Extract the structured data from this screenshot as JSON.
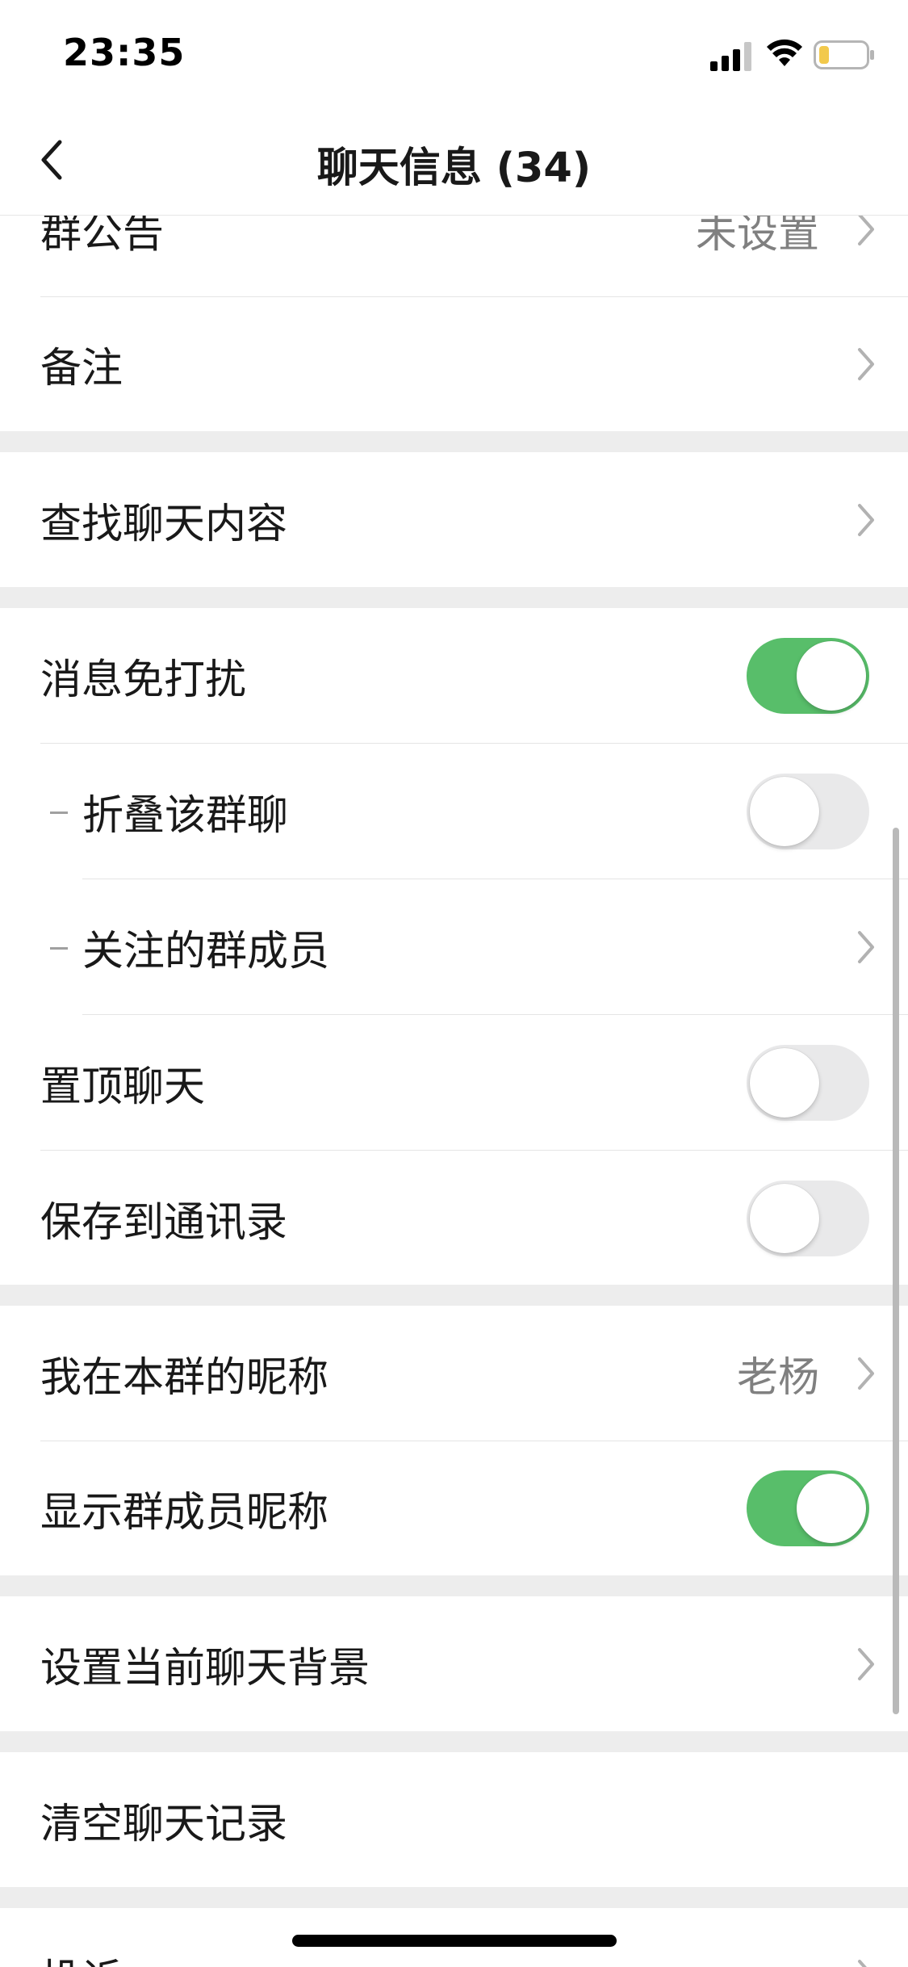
{
  "status_bar": {
    "time": "23:35",
    "icons": [
      "signal-icon",
      "wifi-icon",
      "battery-icon"
    ]
  },
  "nav": {
    "title": "聊天信息 (34)",
    "back_icon": "chevron-left-icon"
  },
  "rows": {
    "announcement": {
      "label": "群公告",
      "value": "未设置"
    },
    "remark": {
      "label": "备注"
    },
    "search_chat": {
      "label": "查找聊天内容"
    },
    "mute": {
      "label": "消息免打扰",
      "toggle": "on"
    },
    "fold_chat": {
      "label": "折叠该群聊",
      "toggle": "off"
    },
    "followed_members": {
      "label": "关注的群成员"
    },
    "pin_chat": {
      "label": "置顶聊天",
      "toggle": "off"
    },
    "save_contacts": {
      "label": "保存到通讯录",
      "toggle": "off"
    },
    "my_nickname": {
      "label": "我在本群的昵称",
      "value": "老杨"
    },
    "show_nicknames": {
      "label": "显示群成员昵称",
      "toggle": "on"
    },
    "chat_background": {
      "label": "设置当前聊天背景"
    },
    "clear_history": {
      "label": "清空聊天记录"
    },
    "report": {
      "label": "投诉"
    }
  },
  "colors": {
    "toggle_on": "#58BE6A",
    "toggle_off": "#E9E9EA",
    "background": "#EDEDED",
    "cell": "#FFFFFF",
    "secondary_text": "#808080"
  }
}
